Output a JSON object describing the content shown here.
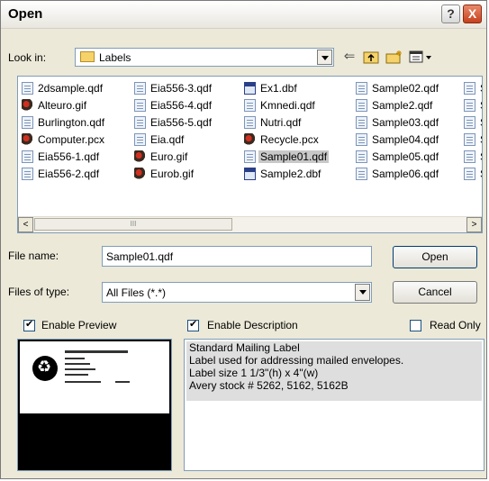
{
  "window": {
    "title": "Open",
    "help_glyph": "?",
    "close_glyph": "X"
  },
  "look_in": {
    "label": "Look in:",
    "value": "Labels"
  },
  "icons": {
    "back": "back-arrow-icon",
    "up_folder": "up-folder-icon",
    "new_folder": "new-folder-icon",
    "view_menu": "view-menu-icon"
  },
  "files": {
    "columns": [
      [
        {
          "name": "2dsample.qdf",
          "type": "qdf"
        },
        {
          "name": "Alteuro.gif",
          "type": "gif"
        },
        {
          "name": "Burlington.qdf",
          "type": "qdf"
        },
        {
          "name": "Computer.pcx",
          "type": "gif"
        },
        {
          "name": "Eia556-1.qdf",
          "type": "qdf"
        },
        {
          "name": "Eia556-2.qdf",
          "type": "qdf"
        }
      ],
      [
        {
          "name": "Eia556-3.qdf",
          "type": "qdf"
        },
        {
          "name": "Eia556-4.qdf",
          "type": "qdf"
        },
        {
          "name": "Eia556-5.qdf",
          "type": "qdf"
        },
        {
          "name": "Eia.qdf",
          "type": "qdf"
        },
        {
          "name": "Euro.gif",
          "type": "gif"
        },
        {
          "name": "Eurob.gif",
          "type": "gif"
        }
      ],
      [
        {
          "name": "Ex1.dbf",
          "type": "dbf"
        },
        {
          "name": "Kmnedi.qdf",
          "type": "qdf"
        },
        {
          "name": "Nutri.qdf",
          "type": "qdf"
        },
        {
          "name": "Recycle.pcx",
          "type": "gif"
        },
        {
          "name": "Sample01.qdf",
          "type": "qdf",
          "selected": true
        },
        {
          "name": "Sample2.dbf",
          "type": "dbf"
        }
      ],
      [
        {
          "name": "Sample02.qdf",
          "type": "qdf"
        },
        {
          "name": "Sample2.qdf",
          "type": "qdf"
        },
        {
          "name": "Sample03.qdf",
          "type": "qdf"
        },
        {
          "name": "Sample04.qdf",
          "type": "qdf"
        },
        {
          "name": "Sample05.qdf",
          "type": "qdf"
        },
        {
          "name": "Sample06.qdf",
          "type": "qdf"
        }
      ],
      [
        {
          "name": "S",
          "type": "qdf"
        },
        {
          "name": "S",
          "type": "qdf"
        },
        {
          "name": "S",
          "type": "qdf"
        },
        {
          "name": "S",
          "type": "qdf"
        },
        {
          "name": "S",
          "type": "qdf"
        },
        {
          "name": "S",
          "type": "qdf"
        }
      ]
    ],
    "scroll_left": "<",
    "scroll_right": ">",
    "thumb_grip": "III"
  },
  "file_name": {
    "label": "File name:",
    "value": "Sample01.qdf"
  },
  "files_of_type": {
    "label": "Files of type:",
    "value": "All Files (*.*)"
  },
  "buttons": {
    "open": "Open",
    "cancel": "Cancel"
  },
  "options": {
    "enable_preview": "Enable Preview",
    "enable_description": "Enable Description",
    "read_only": "Read Only"
  },
  "description": {
    "lines": [
      "Standard Mailing Label",
      "Label used for addressing mailed envelopes.",
      "Label size 1 1/3\"(h) x 4\"(w)",
      "Avery stock # 5262, 5162, 5162B"
    ]
  }
}
